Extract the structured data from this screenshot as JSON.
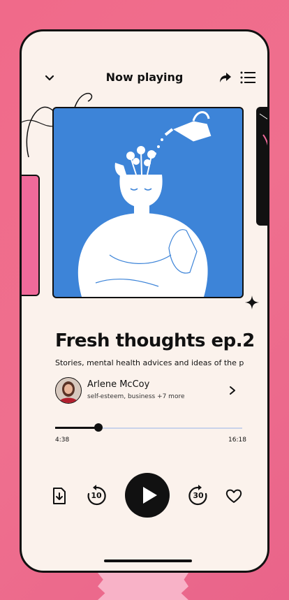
{
  "header": {
    "title": "Now playing",
    "back_icon": "chevron-down-icon",
    "share_icon": "share-icon",
    "queue_icon": "queue-list-icon"
  },
  "episode": {
    "title": "Fresh thoughts ep.2",
    "description": "Stories, mental health advices and ideas of the people"
  },
  "author": {
    "name": "Arlene McCoy",
    "tags": "self-esteem, business +7 more"
  },
  "player": {
    "current_time": "4:38",
    "total_time": "16:18",
    "progress": 0.23
  },
  "controls": {
    "download_icon": "download-icon",
    "rewind_label": "10",
    "forward_label": "30",
    "play_icon": "play-icon",
    "favorite_icon": "heart-icon"
  },
  "colors": {
    "background": "#ef6f8e",
    "screen": "#fbf2ec",
    "artwork": "#3d84d8",
    "accent_pink": "#f06a9a",
    "text": "#111111"
  }
}
